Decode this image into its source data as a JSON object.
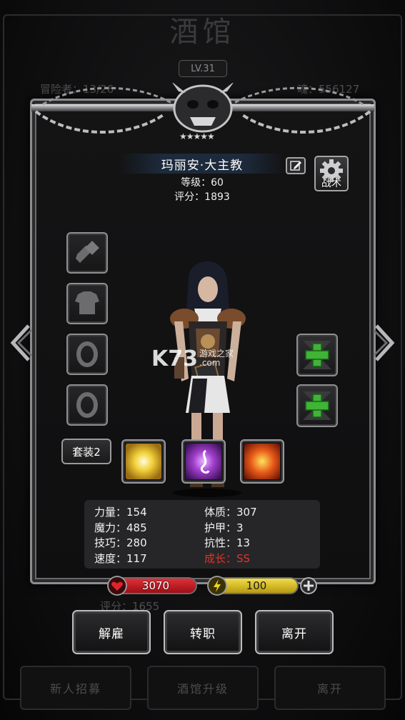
{
  "background": {
    "title": "酒馆",
    "level": "LV.31",
    "adventurers_label": "冒险者：13/26",
    "soul_label": "魂：556127",
    "behind_score": "评分：1655",
    "bottom_buttons": [
      "新人招募",
      "酒馆升级",
      "离开"
    ]
  },
  "hero": {
    "stars": "★★★★★",
    "name": "玛丽安·大主教",
    "level_line": "等级：60",
    "score_line": "评分：1893",
    "tactics_label": "战术"
  },
  "equipment": {
    "left_slots": [
      {
        "icon": "hammer-icon"
      },
      {
        "icon": "armor-icon"
      },
      {
        "icon": "ring-icon"
      },
      {
        "icon": "ring-icon"
      }
    ],
    "right_slots": [
      {
        "icon": "add-icon"
      },
      {
        "icon": "add-icon"
      }
    ],
    "set_label": "套装2"
  },
  "skills": [
    {
      "icon": "burst-skill-icon",
      "color": "#f3d23a"
    },
    {
      "icon": "rune-skill-icon",
      "color": "#a23fcf"
    },
    {
      "icon": "fire-skill-icon",
      "color": "#e85a1a"
    }
  ],
  "stats": {
    "left": [
      "力量：154",
      "魔力：485",
      "技巧：280",
      "速度：117"
    ],
    "right": [
      "体质：307",
      "护甲：3",
      "抗性：13"
    ],
    "growth": "成长：SS"
  },
  "resources": {
    "hp": "3070",
    "energy": "100",
    "hp_color": "#c8161d",
    "energy_color": "#e1c21e"
  },
  "actions": {
    "dismiss": "解雇",
    "job_change": "转职",
    "leave": "离开"
  },
  "watermark": {
    "big": "K73",
    "line1": "游戏之家",
    "line2": ".com"
  }
}
